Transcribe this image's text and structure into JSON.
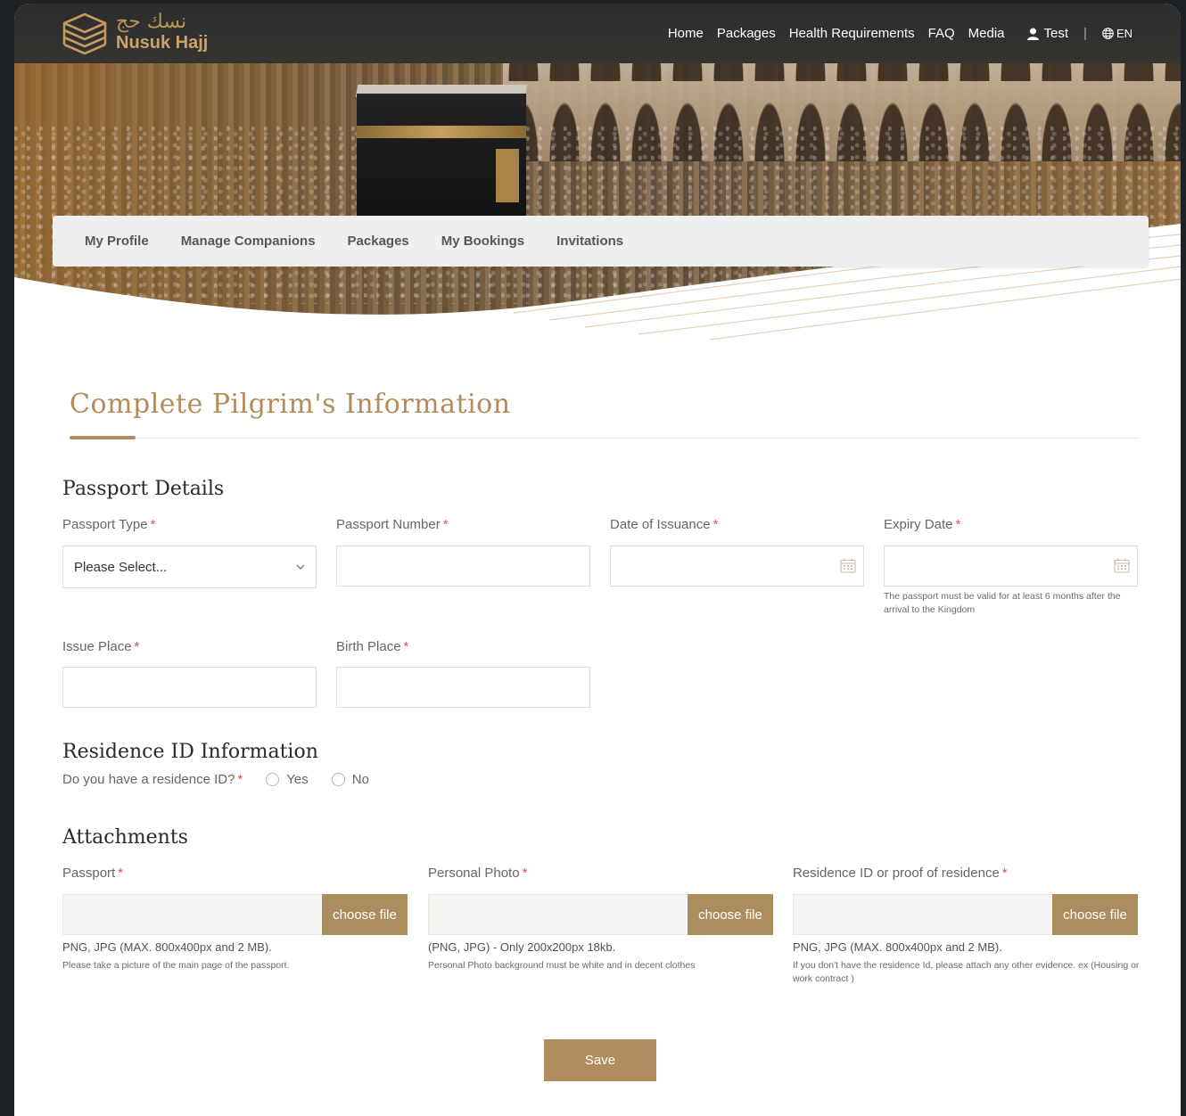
{
  "header": {
    "logo_arabic": "نسك حج",
    "logo_english": "Nusuk Hajj",
    "nav": [
      "Home",
      "Packages",
      "Health Requirements",
      "FAQ",
      "Media"
    ],
    "user_name": "Test",
    "language": "EN"
  },
  "tabs": [
    "My Profile",
    "Manage Companions",
    "Packages",
    "My Bookings",
    "Invitations"
  ],
  "page_title": "Complete Pilgrim's Information",
  "passport": {
    "section_title": "Passport Details",
    "type_label": "Passport Type",
    "type_placeholder": "Please Select...",
    "number_label": "Passport Number",
    "issuance_label": "Date of Issuance",
    "expiry_label": "Expiry Date",
    "expiry_hint": "The passport must be valid for at least 6 months after the arrival to the Kingdom",
    "issue_place_label": "Issue Place",
    "birth_place_label": "Birth Place",
    "required_mark": "*"
  },
  "residence": {
    "section_title": "Residence ID Information",
    "question": "Do you have a residence ID?",
    "yes": "Yes",
    "no": "No"
  },
  "attachments": {
    "section_title": "Attachments",
    "button_label": "choose file",
    "items": [
      {
        "label": "Passport",
        "format": "PNG, JPG (MAX. 800x400px and 2 MB).",
        "note": "Please take a picture of the main page of the passport."
      },
      {
        "label": "Personal Photo",
        "format": "(PNG, JPG) - Only 200x200px 18kb.",
        "note": "Personal Photo background must be white and in decent clothes"
      },
      {
        "label": "Residence ID or proof of residence",
        "format": "PNG, JPG (MAX. 800x400px and 2 MB).",
        "note": "If you don't have the residence Id, please attach any other evidence. ex (Housing or work contract )"
      }
    ]
  },
  "save_label": "Save",
  "colors": {
    "accent": "#b08d5e",
    "title": "#b28c5a",
    "required": "#d9534f"
  }
}
